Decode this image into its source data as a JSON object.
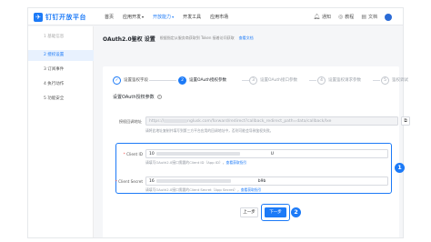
{
  "logo": {
    "text": "钉钉开放平台"
  },
  "nav": {
    "items": [
      {
        "label": "首页"
      },
      {
        "label": "应用开发",
        "has_caret": true
      },
      {
        "label": "开放能力",
        "has_caret": true,
        "active": true
      },
      {
        "label": "开发工具"
      },
      {
        "label": "应用市场"
      }
    ],
    "right": [
      {
        "icon": "bell-icon",
        "label": "通知"
      },
      {
        "icon": "tutorial-icon",
        "label": "教程"
      },
      {
        "icon": "doc-icon",
        "label": "文档"
      }
    ]
  },
  "sidebar": {
    "items": [
      {
        "label": "1 基础信息",
        "state": "ghost"
      },
      {
        "label": "2 授权设置",
        "state": "active"
      },
      {
        "label": "3 订阅事件",
        "state": "normal"
      },
      {
        "label": "4 执行动作",
        "state": "normal"
      },
      {
        "label": "5 功能安全",
        "state": "normal"
      }
    ]
  },
  "page": {
    "title": "OAuth2.0鉴权 设置",
    "desc": "根据指定从服务商获取到 Token 接着访问获取",
    "link": "查看文档"
  },
  "steps": [
    {
      "num": "✓",
      "label": "设置鉴权字段",
      "state": "done"
    },
    {
      "num": "2",
      "label": "设置OAuth授权参数",
      "state": "current"
    },
    {
      "num": "3",
      "label": "设置OAuth接口参数",
      "state": "todo"
    },
    {
      "num": "4",
      "label": "设置鉴权请求参数",
      "state": "todo"
    },
    {
      "num": "5",
      "label": "鉴权调试",
      "state": "todo"
    }
  ],
  "section": {
    "title": "设置OAuth授权参数"
  },
  "callback": {
    "label": "授权回调地址",
    "value_prefix": "https://",
    "value_mid": "nglusk.com/forward/redirect?callback_redirect_path=data/callback/lxe",
    "hint": "请将此地址复制并填写到第三方平台应用的回调地址中，否则可能会导致鉴权失败。"
  },
  "client_id": {
    "label": "Client ID",
    "value_prefix": "10",
    "value_suffix": "U",
    "hint_prefix": "请填写OAuth2.0接口需要的Client ID（App ID）",
    "hint_link": "查看获取指引"
  },
  "client_secret": {
    "label": "Client Secret",
    "value_prefix": "16",
    "value_suffix": "b9b",
    "hint_prefix": "请填写OAuth2.0接口需要的Client Secret（App Secret）",
    "hint_link": "查看获取指引"
  },
  "buttons": {
    "prev": "上一步",
    "next": "下一步"
  },
  "annotations": {
    "badge1": "1",
    "badge2": "2"
  },
  "colors": {
    "accent": "#1c7af7",
    "required": "#f54a45"
  }
}
